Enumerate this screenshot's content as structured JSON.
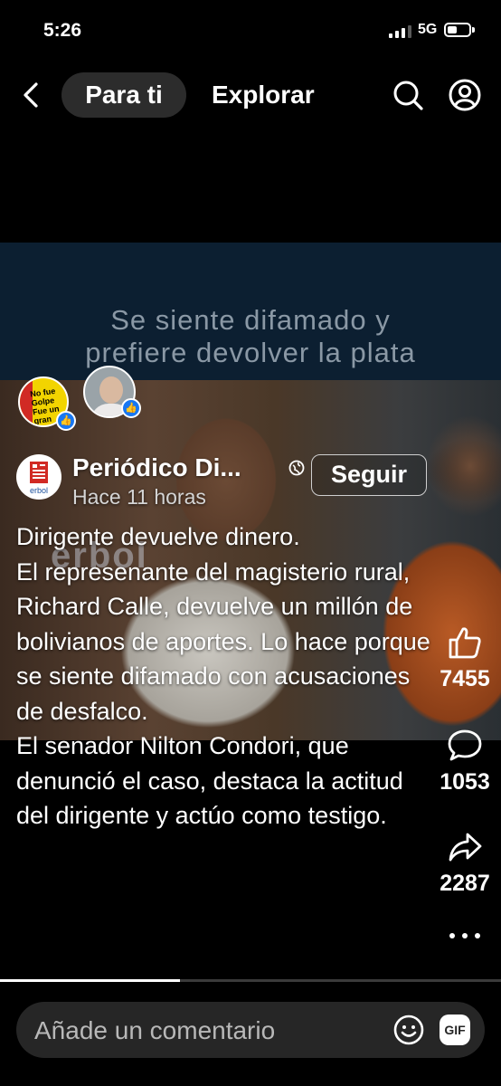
{
  "status": {
    "time": "5:26",
    "network": "5G",
    "battery_level": 0.55,
    "signal_bars": 3
  },
  "nav": {
    "tab_active": "Para ti",
    "tab_other": "Explorar"
  },
  "video": {
    "caption_line1": "Se siente difamado y",
    "caption_line2": "prefiere devolver la plata",
    "watermark": "erbol"
  },
  "badges": {
    "badge1_text": "No fue Golpe Fue un gran fraude"
  },
  "page": {
    "name": "Periódico Di...",
    "follow_label": "Seguir",
    "time_ago": "Hace 11 horas",
    "avatar_label": "erbol"
  },
  "post": {
    "lines": [
      "Dirigente devuelve dinero.",
      "El represenante del magisterio rural, Richard Calle, devuelve un millón de bolivianos de aportes. Lo hace porque se siente difamado con acusaciones de desfalco.",
      "El senador Nilton Condori, que denunció el caso, destaca la actitud del dirigente y actúo como testigo."
    ]
  },
  "actions": {
    "likes": "7455",
    "comments": "1053",
    "shares": "2287"
  },
  "progress": {
    "fraction": 0.36
  },
  "comment": {
    "placeholder": "Añade un comentario",
    "gif_label": "GIF"
  },
  "colors": {
    "like_blue": "#1877f2",
    "erbol_red": "#d12a24"
  }
}
